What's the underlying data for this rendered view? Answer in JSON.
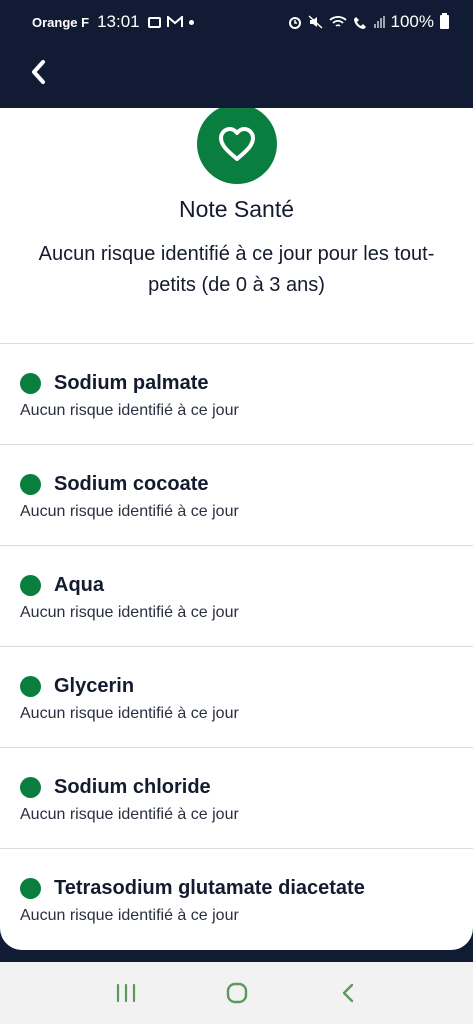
{
  "status_bar": {
    "carrier": "Orange F",
    "time": "13:01",
    "battery": "100%"
  },
  "nav": {
    "back_icon": "chevron-left-icon"
  },
  "header": {
    "icon": "heart-icon",
    "title": "Note Santé",
    "subtitle": "Aucun risque identifié à ce jour pour les tout-petits (de 0 à 3 ans)"
  },
  "ingredients": [
    {
      "name": "Sodium palmate",
      "status": "Aucun risque identifié à ce jour",
      "color": "#0a7e3e"
    },
    {
      "name": "Sodium cocoate",
      "status": "Aucun risque identifié à ce jour",
      "color": "#0a7e3e"
    },
    {
      "name": "Aqua",
      "status": "Aucun risque identifié à ce jour",
      "color": "#0a7e3e"
    },
    {
      "name": "Glycerin",
      "status": "Aucun risque identifié à ce jour",
      "color": "#0a7e3e"
    },
    {
      "name": "Sodium chloride",
      "status": "Aucun risque identifié à ce jour",
      "color": "#0a7e3e"
    },
    {
      "name": "Tetrasodium glutamate diacetate",
      "status": "Aucun risque identifié à ce jour",
      "color": "#0a7e3e"
    }
  ],
  "colors": {
    "header_bg": "#111c34",
    "accent_green": "#0a7e3e",
    "text": "#141b2e"
  },
  "system_nav": {
    "recents_icon": "recents-icon",
    "home_icon": "home-icon",
    "back_icon": "back-icon"
  }
}
